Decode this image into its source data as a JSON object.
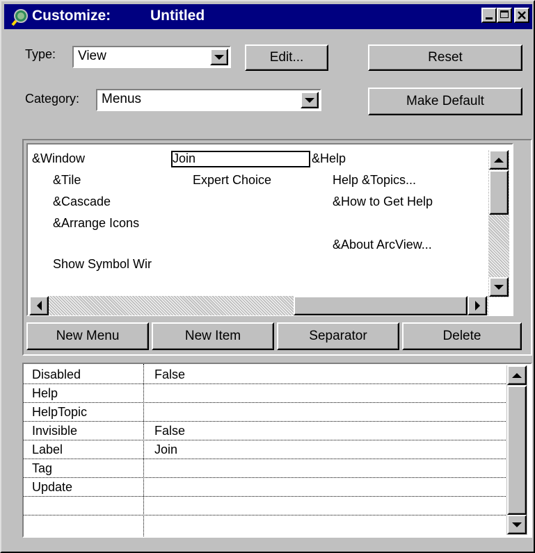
{
  "window": {
    "title_app": "Customize:",
    "title_doc": "Untitled",
    "icon": "magnifier-globe-icon",
    "controls": [
      "minimize-icon",
      "maximize-icon",
      "close-icon"
    ]
  },
  "form": {
    "type_label": "Type:",
    "type_value": "View",
    "category_label": "Category:",
    "category_value": "Menus",
    "edit_button": "Edit...",
    "reset_button": "Reset",
    "make_default_button": "Make Default"
  },
  "menus": {
    "columns": [
      {
        "header": "&Window",
        "items": [
          "&Tile",
          "&Cascade",
          "&Arrange Icons",
          "",
          "Show Symbol Wir"
        ]
      },
      {
        "header": "Join",
        "items": [
          "Expert Choice"
        ]
      },
      {
        "header": "&Help",
        "items": [
          "Help &Topics...",
          "&How to Get Help",
          "",
          "&About ArcView..."
        ]
      }
    ],
    "selected": "Join"
  },
  "menu_buttons": {
    "new_menu": "New Menu",
    "new_item": "New Item",
    "separator": "Separator",
    "delete": "Delete"
  },
  "properties": [
    {
      "key": "Disabled",
      "value": "False"
    },
    {
      "key": "Help",
      "value": ""
    },
    {
      "key": "HelpTopic",
      "value": ""
    },
    {
      "key": "Invisible",
      "value": "False"
    },
    {
      "key": "Label",
      "value": "Join"
    },
    {
      "key": "Tag",
      "value": ""
    },
    {
      "key": "Update",
      "value": ""
    },
    {
      "key": "",
      "value": ""
    }
  ],
  "colors": {
    "titlebar": "#000080",
    "face": "#c0c0c0",
    "window_bg": "#ffffff"
  }
}
